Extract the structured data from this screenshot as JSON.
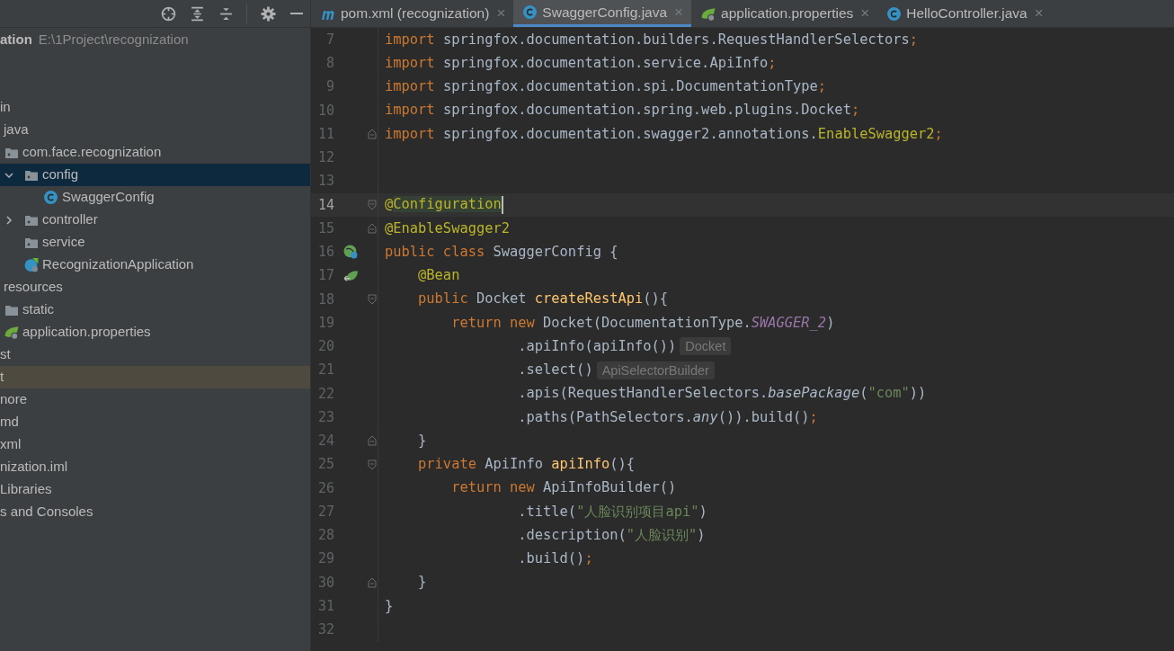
{
  "project_panel": {
    "toolbar": [
      {
        "kind": "locate"
      },
      {
        "kind": "expand"
      },
      {
        "kind": "collapse"
      },
      {
        "kind": "settings"
      },
      {
        "kind": "hide"
      }
    ],
    "project": {
      "name": "ation",
      "path": "E:\\1Project\\recognization"
    },
    "tree": [
      {
        "selected": false,
        "highlighted": false
      },
      {
        "selected": false,
        "highlighted": false
      },
      {
        "label": "in",
        "selected": false,
        "highlighted": false,
        "children": [
          {
            "label": "java",
            "selected": false,
            "highlighted": false,
            "children": [
              {
                "label": "com.face.recognization",
                "kind": "package",
                "selected": false,
                "highlighted": false,
                "children": [
                  {
                    "label": "config",
                    "kind": "package",
                    "expanded": true,
                    "selected": true,
                    "highlighted": false,
                    "children": [
                      {
                        "label": "SwaggerConfig",
                        "kind": "class",
                        "selected": false,
                        "highlighted": false
                      }
                    ]
                  },
                  {
                    "label": "controller",
                    "kind": "package",
                    "expanded": false,
                    "selected": false,
                    "highlighted": false
                  },
                  {
                    "label": "service",
                    "kind": "package",
                    "selected": false,
                    "highlighted": false
                  },
                  {
                    "label": "RecognizationApplication",
                    "kind": "spring-class",
                    "selected": false,
                    "highlighted": false
                  }
                ]
              }
            ]
          },
          {
            "label": "resources",
            "selected": false,
            "highlighted": false,
            "children": [
              {
                "label": "static",
                "kind": "folder",
                "selected": false,
                "highlighted": false
              },
              {
                "label": "application.properties",
                "kind": "spring",
                "selected": false,
                "highlighted": false
              }
            ]
          }
        ]
      },
      {
        "label": "st",
        "selected": false,
        "highlighted": false
      },
      {
        "label": "t",
        "selected": false,
        "highlighted": true
      },
      {
        "label": "nore",
        "selected": false,
        "highlighted": false
      },
      {
        "label": "md",
        "selected": false,
        "highlighted": false
      },
      {
        "label": "xml",
        "selected": false,
        "highlighted": false
      },
      {
        "label": "nization.iml",
        "selected": false,
        "highlighted": false
      },
      {
        "label": "Libraries",
        "selected": false,
        "highlighted": false
      },
      {
        "label": "s and Consoles",
        "selected": false,
        "highlighted": false
      }
    ]
  },
  "tabs": [
    {
      "label": "pom.xml (recognization)",
      "kind": "maven",
      "selected": false,
      "close": "×"
    },
    {
      "label": "SwaggerConfig.java",
      "kind": "class",
      "selected": true,
      "close": "×"
    },
    {
      "label": "application.properties",
      "kind": "spring",
      "selected": false,
      "close": "×"
    },
    {
      "label": "HelloController.java",
      "kind": "class",
      "selected": false,
      "close": "×"
    }
  ],
  "editor": {
    "lines": [
      {
        "number": "7",
        "current": false,
        "kind": "plain",
        "tokens": [
          {
            "kind": "keyword",
            "text": "import"
          },
          {
            "kind": "plain",
            "text": " springfox.documentation.builders.RequestHandlerSelectors"
          },
          {
            "kind": "keyword",
            "text": ";"
          }
        ]
      },
      {
        "number": "8",
        "current": false,
        "kind": "plain",
        "tokens": [
          {
            "kind": "keyword",
            "text": "import"
          },
          {
            "kind": "plain",
            "text": " springfox.documentation.service.ApiInfo"
          },
          {
            "kind": "keyword",
            "text": ";"
          }
        ]
      },
      {
        "number": "9",
        "current": false,
        "kind": "plain",
        "tokens": [
          {
            "kind": "keyword",
            "text": "import"
          },
          {
            "kind": "plain",
            "text": " springfox.documentation.spi.DocumentationType"
          },
          {
            "kind": "keyword",
            "text": ";"
          }
        ]
      },
      {
        "number": "10",
        "current": false,
        "kind": "plain",
        "tokens": [
          {
            "kind": "keyword",
            "text": "import"
          },
          {
            "kind": "plain",
            "text": " springfox.documentation.spring.web.plugins.Docket"
          },
          {
            "kind": "keyword",
            "text": ";"
          }
        ]
      },
      {
        "number": "11",
        "current": false,
        "kind": "fold_end",
        "tokens": [
          {
            "kind": "keyword",
            "text": "import"
          },
          {
            "kind": "plain",
            "text": " springfox.documentation.swagger2.annotations."
          },
          {
            "kind": "annotation",
            "text": "EnableSwagger2"
          },
          {
            "kind": "keyword",
            "text": ";"
          }
        ]
      },
      {
        "number": "12",
        "current": false,
        "kind": "plain"
      },
      {
        "number": "13",
        "current": false,
        "kind": "plain"
      },
      {
        "number": "14",
        "current": true,
        "kind": "fold_start",
        "tokens": [
          {
            "kind": "annotation",
            "text": "@"
          },
          {
            "kind": "annotation_marked",
            "text": "Configuration"
          }
        ]
      },
      {
        "number": "15",
        "current": false,
        "kind": "fold_end",
        "tokens": [
          {
            "kind": "annotation",
            "text": "@EnableSwagger2"
          }
        ]
      },
      {
        "number": "16",
        "current": false,
        "kind": "bean_class",
        "tokens": [
          {
            "kind": "keyword",
            "text": "public class"
          },
          {
            "kind": "plain",
            "text": " SwaggerConfig {"
          }
        ]
      },
      {
        "number": "17",
        "current": false,
        "kind": "bean_method",
        "tokens": [
          {
            "kind": "annotation",
            "text": "    @Bean"
          }
        ]
      },
      {
        "number": "18",
        "current": false,
        "kind": "fold_start",
        "tokens": [
          {
            "kind": "keyword",
            "text": "    public"
          },
          {
            "kind": "plain",
            "text": " Docket "
          },
          {
            "kind": "method",
            "text": "createRestApi"
          },
          {
            "kind": "plain",
            "text": "(){"
          }
        ]
      },
      {
        "number": "19",
        "current": false,
        "kind": "plain",
        "tokens": [
          {
            "kind": "keyword",
            "text": "        return new"
          },
          {
            "kind": "plain",
            "text": " Docket(DocumentationType."
          },
          {
            "kind": "static",
            "text": "SWAGGER_2"
          },
          {
            "kind": "plain",
            "text": ")"
          }
        ]
      },
      {
        "number": "20",
        "current": false,
        "kind": "plain",
        "tokens": [
          {
            "kind": "plain",
            "text": "                .apiInfo(apiInfo())"
          },
          {
            "kind": "hint",
            "text": "Docket"
          }
        ]
      },
      {
        "number": "21",
        "current": false,
        "kind": "plain",
        "tokens": [
          {
            "kind": "plain",
            "text": "                .select()"
          },
          {
            "kind": "hint",
            "text": "ApiSelectorBuilder"
          }
        ]
      },
      {
        "number": "22",
        "current": false,
        "kind": "plain",
        "tokens": [
          {
            "kind": "plain",
            "text": "                .apis(RequestHandlerSelectors."
          },
          {
            "kind": "italic",
            "text": "basePackage"
          },
          {
            "kind": "plain",
            "text": "("
          },
          {
            "kind": "string",
            "text": "\"com\""
          },
          {
            "kind": "plain",
            "text": "))"
          }
        ]
      },
      {
        "number": "23",
        "current": false,
        "kind": "plain",
        "tokens": [
          {
            "kind": "plain",
            "text": "                .paths(PathSelectors."
          },
          {
            "kind": "italic",
            "text": "any"
          },
          {
            "kind": "plain",
            "text": "()).build()"
          },
          {
            "kind": "keyword",
            "text": ";"
          }
        ]
      },
      {
        "number": "24",
        "current": false,
        "kind": "fold_end",
        "tokens": [
          {
            "kind": "plain",
            "text": "    }"
          }
        ]
      },
      {
        "number": "25",
        "current": false,
        "kind": "fold_start",
        "tokens": [
          {
            "kind": "keyword",
            "text": "    private"
          },
          {
            "kind": "plain",
            "text": " ApiInfo "
          },
          {
            "kind": "method",
            "text": "apiInfo"
          },
          {
            "kind": "plain",
            "text": "(){"
          }
        ]
      },
      {
        "number": "26",
        "current": false,
        "kind": "plain",
        "tokens": [
          {
            "kind": "keyword",
            "text": "        return new"
          },
          {
            "kind": "plain",
            "text": " ApiInfoBuilder()"
          }
        ]
      },
      {
        "number": "27",
        "current": false,
        "kind": "plain",
        "tokens": [
          {
            "kind": "plain",
            "text": "                .title("
          },
          {
            "kind": "string",
            "text": "\"人脸识别项目api\""
          },
          {
            "kind": "plain",
            "text": ")"
          }
        ]
      },
      {
        "number": "28",
        "current": false,
        "kind": "plain",
        "tokens": [
          {
            "kind": "plain",
            "text": "                .description("
          },
          {
            "kind": "string",
            "text": "\"人脸识别\""
          },
          {
            "kind": "plain",
            "text": ")"
          }
        ]
      },
      {
        "number": "29",
        "current": false,
        "kind": "plain",
        "tokens": [
          {
            "kind": "plain",
            "text": "                .build()"
          },
          {
            "kind": "keyword",
            "text": ";"
          }
        ]
      },
      {
        "number": "30",
        "current": false,
        "kind": "fold_end",
        "tokens": [
          {
            "kind": "plain",
            "text": "    }"
          }
        ]
      },
      {
        "number": "31",
        "current": false,
        "kind": "plain",
        "tokens": [
          {
            "kind": "plain",
            "text": "}"
          }
        ]
      },
      {
        "number": "32",
        "current": false,
        "kind": "plain"
      }
    ]
  }
}
